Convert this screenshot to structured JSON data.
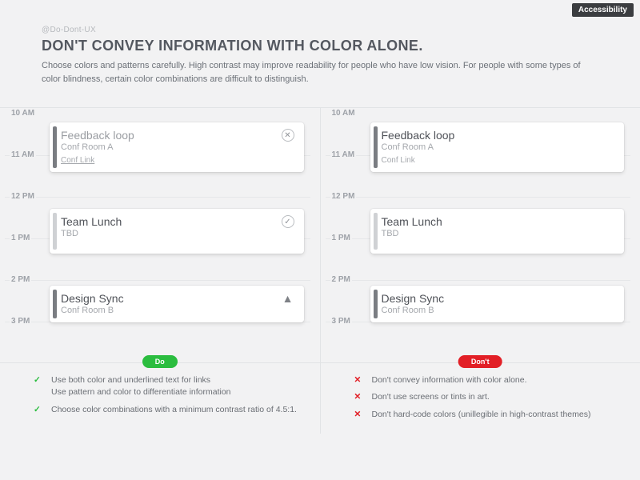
{
  "badge": "Accessibility",
  "handle": "@Do-Dont-UX",
  "title": "DON'T CONVEY INFORMATION WITH COLOR ALONE.",
  "description": "Choose colors and patterns carefully. High contrast may improve readability for people who have low vision. For people with some types of color blindness, certain color combinations are difficult to distinguish.",
  "times": [
    "10 AM",
    "11 AM",
    "12 PM",
    "1 PM",
    "2 PM",
    "3 PM"
  ],
  "events": {
    "e1": {
      "title": "Feedback loop",
      "sub": "Conf Room A",
      "link": "Conf Link",
      "bar": "#7a7d82"
    },
    "e2": {
      "title": "Team Lunch",
      "sub": "TBD",
      "bar": "#cfd1d4"
    },
    "e3": {
      "title": "Design Sync",
      "sub": "Conf Room B",
      "bar": "#7a7d82"
    }
  },
  "pills": {
    "do": "Do",
    "dont": "Don't"
  },
  "do_tips": [
    "Use both color and underlined text for links\nUse pattern and color to differentiate information",
    "Choose color combinations with a minimum contrast ratio of 4.5:1."
  ],
  "dont_tips": [
    "Don't convey information with color alone.",
    "Don't use screens or tints in art.",
    "Don't hard-code colors (unillegible in high-contrast themes)"
  ]
}
